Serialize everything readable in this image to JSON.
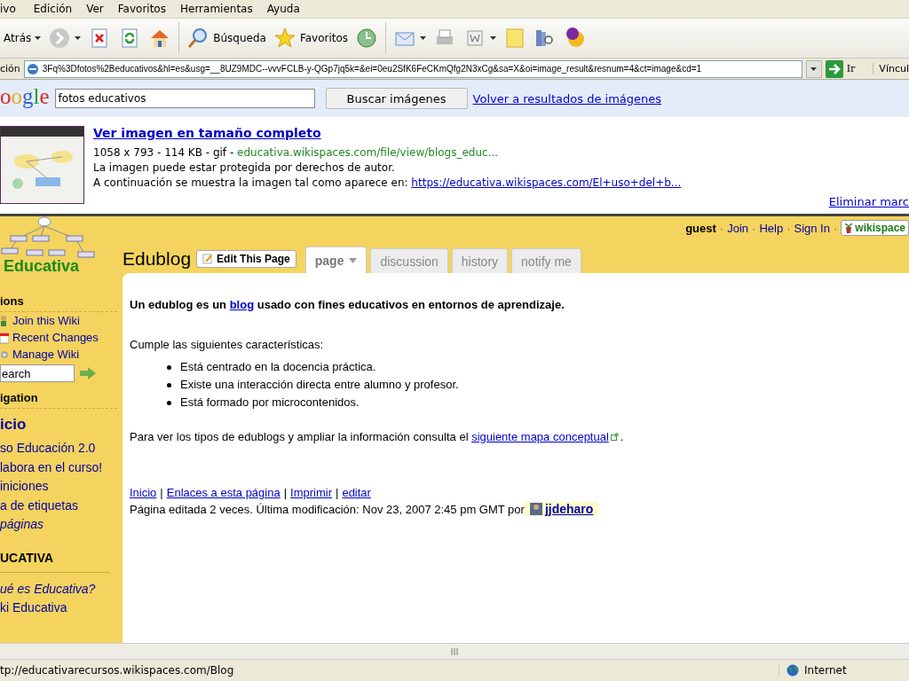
{
  "menu_bar": [
    "ivo",
    "Edición",
    "Ver",
    "Favoritos",
    "Herramientas",
    "Ayuda"
  ],
  "toolbar": [
    {
      "kind": "back",
      "label": "Atrás"
    },
    {
      "kind": "forward"
    },
    {
      "kind": "stop"
    },
    {
      "kind": "refresh"
    },
    {
      "kind": "home"
    },
    {
      "kind": "sep"
    },
    {
      "kind": "search",
      "label": "Búsqueda"
    },
    {
      "kind": "favorites",
      "label": "Favoritos"
    },
    {
      "kind": "history"
    },
    {
      "kind": "sep"
    },
    {
      "kind": "mail"
    },
    {
      "kind": "print"
    },
    {
      "kind": "word"
    },
    {
      "kind": "note"
    },
    {
      "kind": "research"
    },
    {
      "kind": "messenger"
    }
  ],
  "address_bar": {
    "label": "ción",
    "url": "3Fq%3Dfotos%2Beducativos&hl=es&usg=__8UZ9MDC--vvvFCLB-y-QGp7jq5k=&ei=0eu2SfK6FeCKmQfg2N3xCg&sa=X&oi=image_result&resnum=4&ct=image&cd=1",
    "go": "Ir",
    "links": "Víncul"
  },
  "google_bar": {
    "logo": "oogle",
    "query": "fotos educativos",
    "search_button": "Buscar imágenes",
    "back_link": "Volver a resultados de imágenes"
  },
  "result": {
    "title": "Ver imagen en tamaño completo",
    "meta": "1058 x 793 - 114 KB - gif - ",
    "source": "educativa.wikispaces.com/file/view/blogs_educ...",
    "copyright": "La imagen puede estar protegida por derechos de autor.",
    "shown_in": "A continuación se muestra la imagen tal como aparece en: ",
    "shown_url": "https://educativa.wikispaces.com/El+uso+del+b...",
    "remove": "Eliminar marc"
  },
  "wiki": {
    "logo": "Educativa",
    "user": "guest",
    "top_links": [
      {
        "sep": "·",
        "label": "Join"
      },
      {
        "sep": "·",
        "label": "Help"
      },
      {
        "sep": "·",
        "label": "Sign In"
      }
    ],
    "top_end_sep": "·",
    "brand": "wikispace",
    "sidebar": {
      "actions_heading": "ions",
      "actions": [
        {
          "kind": "join",
          "label": "Join this Wiki"
        },
        {
          "kind": "changes",
          "label": "Recent Changes"
        },
        {
          "kind": "manage",
          "label": "Manage Wiki"
        }
      ],
      "search_value": "earch",
      "nav_heading": "igation",
      "nav_home": "icio",
      "nav": [
        {
          "label": "so Educación 2.0",
          "italic": false
        },
        {
          "label": "labora en el curso!",
          "italic": false
        },
        {
          "label": "iniciones",
          "italic": false
        },
        {
          "label": "a de etiquetas",
          "italic": false
        },
        {
          "label": "páginas",
          "italic": true
        }
      ],
      "section_heading": "UCATIVA",
      "section_links": [
        {
          "label": "ué es Educativa?",
          "italic": true
        },
        {
          "label": "ki Educativa",
          "italic": false
        }
      ]
    },
    "page_title": "Edublog",
    "edit_button": "Edit This Page",
    "tabs": [
      {
        "label": "page",
        "selected": true
      },
      {
        "label": "discussion",
        "selected": false
      },
      {
        "label": "history",
        "selected": false
      },
      {
        "label": "notify me",
        "selected": false
      }
    ],
    "intro_before": "Un edublog es un ",
    "intro_link": "blog",
    "intro_after": " usado con fines educativos en entornos de aprendizaje.",
    "features_intro": "Cumple las siguientes características:",
    "features": [
      "Está centrado en la docencia práctica.",
      "Existe una interacción directa entre alumno y profesor.",
      "Está formado por microcontenidos."
    ],
    "map_text": "Para ver los tipos de edublogs y ampliar la información consulta el ",
    "map_link": "siguiente mapa conceptual",
    "map_end": ".",
    "footer_links": [
      {
        "label": "Inicio"
      },
      {
        "sep": "|",
        "label": "Enlaces a esta página"
      },
      {
        "sep": "|",
        "label": "Imprimir"
      },
      {
        "sep": "|",
        "label": "editar"
      }
    ],
    "edited": "Página editada 2 veces. Última modificación: Nov 23, 2007 2:45 pm GMT por ",
    "author": "jjdeharo"
  },
  "status_bar": {
    "url": "tp://educativarecursos.wikispaces.com/Blog",
    "zone": "Internet"
  }
}
